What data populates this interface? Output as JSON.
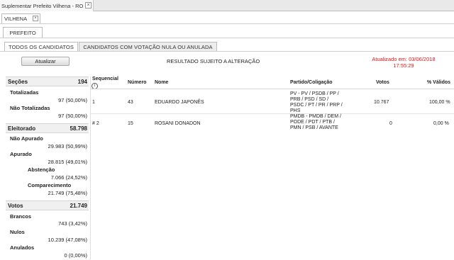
{
  "window": {
    "tab_title": "Suplementar Prefeito Vilhena - RO",
    "close_glyph": "×"
  },
  "city_tab": {
    "label": "VILHENA",
    "close_glyph": "×"
  },
  "office_tab": {
    "label": "PREFEITO"
  },
  "result_tabs": [
    {
      "label": "TODOS OS CANDIDATOS",
      "active": true
    },
    {
      "label": "CANDIDATOS COM VOTAÇÃO NULA OU ANULADA",
      "active": false
    }
  ],
  "toolbar": {
    "update_button": "Atualizar",
    "subject_note": "RESULTADO SUJEITO A ALTERAÇÃO",
    "updated_line1": "Atualizado em: 03/06/2018",
    "updated_line2": "17:55:29"
  },
  "summary": {
    "secoes": {
      "label": "Seções",
      "value": "194",
      "totalizadas_label": "Totalizadas",
      "totalizadas_value": "97 (50,00%)",
      "nao_totalizadas_label": "Não Totalizadas",
      "nao_totalizadas_value": "97 (50,00%)"
    },
    "eleitorado": {
      "label": "Eleitorado",
      "value": "58.798",
      "nao_apurado_label": "Não Apurado",
      "nao_apurado_value": "29.983 (50,99%)",
      "apurado_label": "Apurado",
      "apurado_value": "28.815 (49,01%)",
      "abstencao_label": "Abstenção",
      "abstencao_value": "7.066 (24,52%)",
      "comparecimento_label": "Comparecimento",
      "comparecimento_value": "21.749 (75,48%)"
    },
    "votos": {
      "label": "Votos",
      "value": "21.749",
      "brancos_label": "Brancos",
      "brancos_value": "743 (3,42%)",
      "nulos_label": "Nulos",
      "nulos_value": "10.239 (47,08%)",
      "anulados_label": "Anulados",
      "anulados_value": "0 (0,00%)"
    }
  },
  "table": {
    "headers": {
      "sequencial": "Sequencial",
      "numero": "Número",
      "nome": "Nome",
      "partido": "Partido/Coligação",
      "votos": "Votos",
      "validos": "% Válidos"
    },
    "info_glyph": "i",
    "rows": [
      {
        "seq": "1",
        "numero": "43",
        "nome": "EDUARDO JAPONÊS",
        "partido_lines": [
          "PV - PV / PSDB / PP /",
          "PRB / PSD / SD /",
          "PSDC / PT / PR / PRP /",
          "PHS"
        ],
        "votos": "10.767",
        "validos": "100,00 %"
      },
      {
        "seq": "# 2",
        "numero": "15",
        "nome": "ROSANI DONADON",
        "partido_lines": [
          "PMDB - PMDB / DEM /",
          "PODE / PDT / PTB /",
          "PMN / PSB / AVANTE"
        ],
        "votos": "0",
        "validos": "0,00 %"
      }
    ]
  }
}
